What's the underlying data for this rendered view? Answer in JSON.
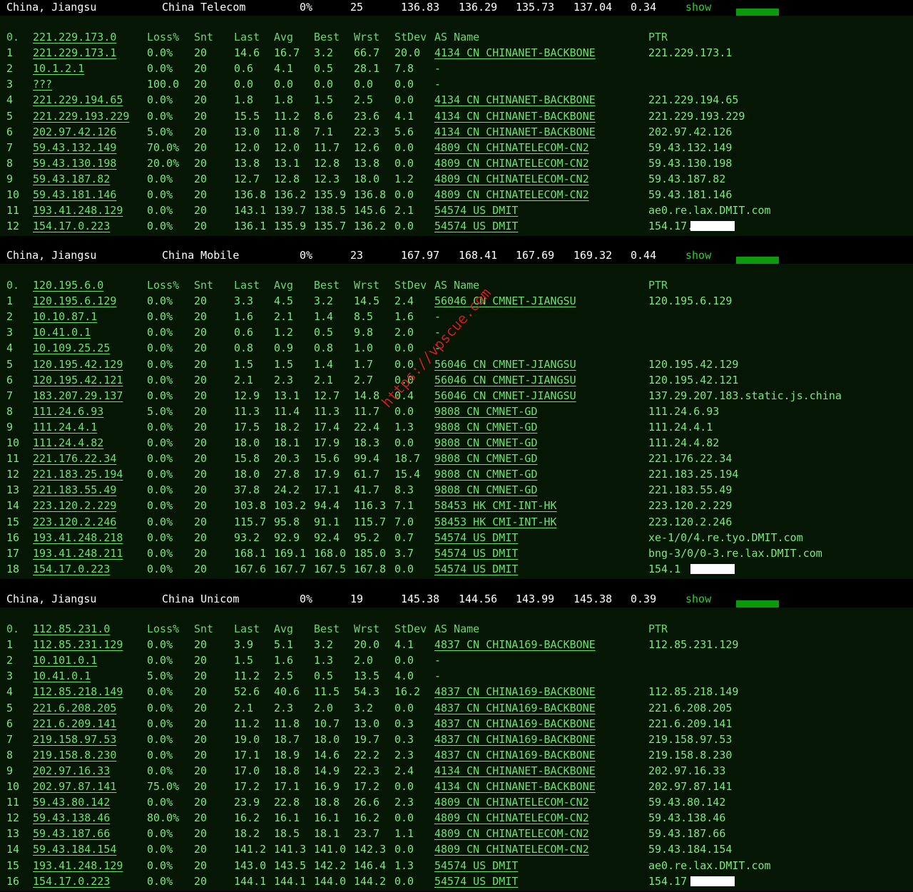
{
  "columns": {
    "hop": "0.",
    "loss": "Loss%",
    "snt": "Snt",
    "last": "Last",
    "avg": "Avg",
    "best": "Best",
    "wrst": "Wrst",
    "stdev": "StDev",
    "asname": "AS Name",
    "ptr": "PTR"
  },
  "sections": [
    {
      "header": {
        "location": "China, Jiangsu",
        "isp": "China Telecom",
        "loss": "0%",
        "hops": "25",
        "v1": "136.83",
        "v2": "136.29",
        "v3": "135.73",
        "v4": "137.04",
        "v5": "0.34",
        "show": "show"
      },
      "first_ip": "221.229.173.0",
      "rows": [
        {
          "n": "1",
          "ip": "221.229.173.1",
          "loss": "0.0%",
          "snt": "20",
          "last": "14.6",
          "avg": "16.7",
          "best": "3.2",
          "wrst": "66.7",
          "stdev": "20.0",
          "as": "4134  CN CHINANET-BACKBONE",
          "ptr": "221.229.173.1"
        },
        {
          "n": "2",
          "ip": "10.1.2.1",
          "loss": "0.0%",
          "snt": "20",
          "last": "0.6",
          "avg": "4.1",
          "best": "0.5",
          "wrst": "28.1",
          "stdev": "7.8",
          "as": "-",
          "ptr": ""
        },
        {
          "n": "3",
          "ip": "???",
          "loss": "100.0",
          "snt": "20",
          "last": "0.0",
          "avg": "0.0",
          "best": "0.0",
          "wrst": "0.0",
          "stdev": "0.0",
          "as": "-",
          "ptr": ""
        },
        {
          "n": "4",
          "ip": "221.229.194.65",
          "loss": "0.0%",
          "snt": "20",
          "last": "1.8",
          "avg": "1.8",
          "best": "1.5",
          "wrst": "2.5",
          "stdev": "0.0",
          "as": "4134  CN CHINANET-BACKBONE",
          "ptr": "221.229.194.65"
        },
        {
          "n": "5",
          "ip": "221.229.193.229",
          "loss": "0.0%",
          "snt": "20",
          "last": "15.5",
          "avg": "11.2",
          "best": "8.6",
          "wrst": "23.6",
          "stdev": "4.1",
          "as": "4134  CN CHINANET-BACKBONE",
          "ptr": "221.229.193.229"
        },
        {
          "n": "6",
          "ip": "202.97.42.126",
          "loss": "5.0%",
          "snt": "20",
          "last": "13.0",
          "avg": "11.8",
          "best": "7.1",
          "wrst": "22.3",
          "stdev": "5.6",
          "as": "4134  CN CHINANET-BACKBONE",
          "ptr": "202.97.42.126"
        },
        {
          "n": "7",
          "ip": "59.43.132.149",
          "loss": "70.0%",
          "snt": "20",
          "last": "12.0",
          "avg": "12.0",
          "best": "11.7",
          "wrst": "12.6",
          "stdev": "0.0",
          "as": "4809  CN CHINATELECOM-CN2",
          "ptr": "59.43.132.149"
        },
        {
          "n": "8",
          "ip": "59.43.130.198",
          "loss": "20.0%",
          "snt": "20",
          "last": "13.8",
          "avg": "13.1",
          "best": "12.8",
          "wrst": "13.8",
          "stdev": "0.0",
          "as": "4809  CN CHINATELECOM-CN2",
          "ptr": "59.43.130.198"
        },
        {
          "n": "9",
          "ip": "59.43.187.82",
          "loss": "0.0%",
          "snt": "20",
          "last": "12.7",
          "avg": "12.8",
          "best": "12.3",
          "wrst": "18.0",
          "stdev": "1.2",
          "as": "4809  CN CHINATELECOM-CN2",
          "ptr": "59.43.187.82"
        },
        {
          "n": "10",
          "ip": "59.43.181.146",
          "loss": "0.0%",
          "snt": "20",
          "last": "136.8",
          "avg": "136.2",
          "best": "135.9",
          "wrst": "136.8",
          "stdev": "0.0",
          "as": "4809  CN CHINATELECOM-CN2",
          "ptr": "59.43.181.146"
        },
        {
          "n": "11",
          "ip": "193.41.248.129",
          "loss": "0.0%",
          "snt": "20",
          "last": "143.1",
          "avg": "139.7",
          "best": "138.5",
          "wrst": "145.6",
          "stdev": "2.1",
          "as": "54574 US DMIT",
          "ptr": "ae0.re.lax.DMIT.com"
        },
        {
          "n": "12",
          "ip": "154.17.0.223",
          "loss": "0.0%",
          "snt": "20",
          "last": "136.1",
          "avg": "135.9",
          "best": "135.7",
          "wrst": "136.2",
          "stdev": "0.0",
          "as": "54574 US DMIT",
          "ptr": "154.17.",
          "mask": true
        }
      ]
    },
    {
      "header": {
        "location": "China, Jiangsu",
        "isp": "China Mobile",
        "loss": "0%",
        "hops": "23",
        "v1": "167.97",
        "v2": "168.41",
        "v3": "167.69",
        "v4": "169.32",
        "v5": "0.44",
        "show": "show"
      },
      "first_ip": "120.195.6.0",
      "rows": [
        {
          "n": "1",
          "ip": "120.195.6.129",
          "loss": "0.0%",
          "snt": "20",
          "last": "3.3",
          "avg": "4.5",
          "best": "3.2",
          "wrst": "14.5",
          "stdev": "2.4",
          "as": "56046 CN CMNET-JIANGSU",
          "ptr": "120.195.6.129"
        },
        {
          "n": "2",
          "ip": "10.10.87.1",
          "loss": "0.0%",
          "snt": "20",
          "last": "1.6",
          "avg": "2.1",
          "best": "1.4",
          "wrst": "8.5",
          "stdev": "1.6",
          "as": "-",
          "ptr": ""
        },
        {
          "n": "3",
          "ip": "10.41.0.1",
          "loss": "0.0%",
          "snt": "20",
          "last": "0.6",
          "avg": "1.2",
          "best": "0.5",
          "wrst": "9.8",
          "stdev": "2.0",
          "as": "-",
          "ptr": ""
        },
        {
          "n": "4",
          "ip": "10.109.25.25",
          "loss": "0.0%",
          "snt": "20",
          "last": "0.8",
          "avg": "0.9",
          "best": "0.8",
          "wrst": "1.0",
          "stdev": "0.0",
          "as": "-",
          "ptr": ""
        },
        {
          "n": "5",
          "ip": "120.195.42.129",
          "loss": "0.0%",
          "snt": "20",
          "last": "1.5",
          "avg": "1.5",
          "best": "1.4",
          "wrst": "1.7",
          "stdev": "0.0",
          "as": "56046 CN CMNET-JIANGSU",
          "ptr": "120.195.42.129"
        },
        {
          "n": "6",
          "ip": "120.195.42.121",
          "loss": "0.0%",
          "snt": "20",
          "last": "2.1",
          "avg": "2.3",
          "best": "2.1",
          "wrst": "2.7",
          "stdev": "0.0",
          "as": "56046 CN CMNET-JIANGSU",
          "ptr": "120.195.42.121"
        },
        {
          "n": "7",
          "ip": "183.207.29.137",
          "loss": "0.0%",
          "snt": "20",
          "last": "12.9",
          "avg": "13.1",
          "best": "12.7",
          "wrst": "14.8",
          "stdev": "0.4",
          "as": "56046 CN CMNET-JIANGSU",
          "ptr": "137.29.207.183.static.js.china"
        },
        {
          "n": "8",
          "ip": "111.24.6.93",
          "loss": "5.0%",
          "snt": "20",
          "last": "11.3",
          "avg": "11.4",
          "best": "11.3",
          "wrst": "11.7",
          "stdev": "0.0",
          "as": "9808  CN CMNET-GD",
          "ptr": "111.24.6.93"
        },
        {
          "n": "9",
          "ip": "111.24.4.1",
          "loss": "0.0%",
          "snt": "20",
          "last": "17.5",
          "avg": "18.2",
          "best": "17.4",
          "wrst": "22.4",
          "stdev": "1.3",
          "as": "9808  CN CMNET-GD",
          "ptr": "111.24.4.1"
        },
        {
          "n": "10",
          "ip": "111.24.4.82",
          "loss": "0.0%",
          "snt": "20",
          "last": "18.0",
          "avg": "18.1",
          "best": "17.9",
          "wrst": "18.3",
          "stdev": "0.0",
          "as": "9808  CN CMNET-GD",
          "ptr": "111.24.4.82"
        },
        {
          "n": "11",
          "ip": "221.176.22.34",
          "loss": "0.0%",
          "snt": "20",
          "last": "15.8",
          "avg": "20.3",
          "best": "15.6",
          "wrst": "99.4",
          "stdev": "18.7",
          "as": "9808  CN CMNET-GD",
          "ptr": "221.176.22.34"
        },
        {
          "n": "12",
          "ip": "221.183.25.194",
          "loss": "0.0%",
          "snt": "20",
          "last": "18.0",
          "avg": "27.8",
          "best": "17.9",
          "wrst": "61.7",
          "stdev": "15.4",
          "as": "9808  CN CMNET-GD",
          "ptr": "221.183.25.194"
        },
        {
          "n": "13",
          "ip": "221.183.55.49",
          "loss": "0.0%",
          "snt": "20",
          "last": "37.8",
          "avg": "24.2",
          "best": "17.1",
          "wrst": "41.7",
          "stdev": "8.3",
          "as": "9808  CN CMNET-GD",
          "ptr": "221.183.55.49"
        },
        {
          "n": "14",
          "ip": "223.120.2.229",
          "loss": "0.0%",
          "snt": "20",
          "last": "103.8",
          "avg": "103.2",
          "best": "94.4",
          "wrst": "116.3",
          "stdev": "7.1",
          "as": "58453 HK CMI-INT-HK",
          "ptr": "223.120.2.229"
        },
        {
          "n": "15",
          "ip": "223.120.2.246",
          "loss": "0.0%",
          "snt": "20",
          "last": "115.7",
          "avg": "95.8",
          "best": "91.1",
          "wrst": "115.7",
          "stdev": "7.0",
          "as": "58453 HK CMI-INT-HK",
          "ptr": "223.120.2.246"
        },
        {
          "n": "16",
          "ip": "193.41.248.218",
          "loss": "0.0%",
          "snt": "20",
          "last": "93.2",
          "avg": "92.9",
          "best": "92.4",
          "wrst": "95.2",
          "stdev": "0.7",
          "as": "54574 US DMIT",
          "ptr": "xe-1/0/4.re.tyo.DMIT.com"
        },
        {
          "n": "17",
          "ip": "193.41.248.211",
          "loss": "0.0%",
          "snt": "20",
          "last": "168.1",
          "avg": "169.1",
          "best": "168.0",
          "wrst": "185.0",
          "stdev": "3.7",
          "as": "54574 US DMIT",
          "ptr": "bng-3/0/0-3.re.lax.DMIT.com"
        },
        {
          "n": "18",
          "ip": "154.17.0.223",
          "loss": "0.0%",
          "snt": "20",
          "last": "167.6",
          "avg": "167.7",
          "best": "167.5",
          "wrst": "167.8",
          "stdev": "0.0",
          "as": "54574 US DMIT",
          "ptr": "154.1",
          "mask": true
        }
      ]
    },
    {
      "header": {
        "location": "China, Jiangsu",
        "isp": "China Unicom",
        "loss": "0%",
        "hops": "19",
        "v1": "145.38",
        "v2": "144.56",
        "v3": "143.99",
        "v4": "145.38",
        "v5": "0.39",
        "show": "show"
      },
      "first_ip": "112.85.231.0",
      "rows": [
        {
          "n": "1",
          "ip": "112.85.231.129",
          "loss": "0.0%",
          "snt": "20",
          "last": "3.9",
          "avg": "5.1",
          "best": "3.2",
          "wrst": "20.0",
          "stdev": "4.1",
          "as": "4837  CN CHINA169-BACKBONE",
          "ptr": "112.85.231.129"
        },
        {
          "n": "2",
          "ip": "10.101.0.1",
          "loss": "0.0%",
          "snt": "20",
          "last": "1.5",
          "avg": "1.6",
          "best": "1.3",
          "wrst": "2.0",
          "stdev": "0.0",
          "as": "-",
          "ptr": ""
        },
        {
          "n": "3",
          "ip": "10.41.0.1",
          "loss": "5.0%",
          "snt": "20",
          "last": "11.2",
          "avg": "2.5",
          "best": "0.5",
          "wrst": "13.5",
          "stdev": "4.0",
          "as": "-",
          "ptr": ""
        },
        {
          "n": "4",
          "ip": "112.85.218.149",
          "loss": "0.0%",
          "snt": "20",
          "last": "52.6",
          "avg": "40.6",
          "best": "11.5",
          "wrst": "54.3",
          "stdev": "16.2",
          "as": "4837  CN CHINA169-BACKBONE",
          "ptr": "112.85.218.149"
        },
        {
          "n": "5",
          "ip": "221.6.208.205",
          "loss": "0.0%",
          "snt": "20",
          "last": "2.1",
          "avg": "2.3",
          "best": "2.0",
          "wrst": "3.2",
          "stdev": "0.0",
          "as": "4837  CN CHINA169-BACKBONE",
          "ptr": "221.6.208.205"
        },
        {
          "n": "6",
          "ip": "221.6.209.141",
          "loss": "0.0%",
          "snt": "20",
          "last": "11.2",
          "avg": "11.8",
          "best": "10.7",
          "wrst": "13.0",
          "stdev": "0.3",
          "as": "4837  CN CHINA169-BACKBONE",
          "ptr": "221.6.209.141"
        },
        {
          "n": "7",
          "ip": "219.158.97.53",
          "loss": "0.0%",
          "snt": "20",
          "last": "19.0",
          "avg": "18.7",
          "best": "18.0",
          "wrst": "19.7",
          "stdev": "0.3",
          "as": "4837  CN CHINA169-BACKBONE",
          "ptr": "219.158.97.53"
        },
        {
          "n": "8",
          "ip": "219.158.8.230",
          "loss": "0.0%",
          "snt": "20",
          "last": "17.1",
          "avg": "18.9",
          "best": "14.6",
          "wrst": "22.2",
          "stdev": "2.3",
          "as": "4837  CN CHINA169-BACKBONE",
          "ptr": "219.158.8.230"
        },
        {
          "n": "9",
          "ip": "202.97.16.33",
          "loss": "0.0%",
          "snt": "20",
          "last": "17.0",
          "avg": "18.8",
          "best": "14.9",
          "wrst": "22.3",
          "stdev": "2.4",
          "as": "4134  CN CHINANET-BACKBONE",
          "ptr": "202.97.16.33"
        },
        {
          "n": "10",
          "ip": "202.97.87.141",
          "loss": "75.0%",
          "snt": "20",
          "last": "17.2",
          "avg": "17.1",
          "best": "16.9",
          "wrst": "17.2",
          "stdev": "0.0",
          "as": "4134  CN CHINANET-BACKBONE",
          "ptr": "202.97.87.141"
        },
        {
          "n": "11",
          "ip": "59.43.80.142",
          "loss": "0.0%",
          "snt": "20",
          "last": "23.9",
          "avg": "22.8",
          "best": "18.8",
          "wrst": "26.6",
          "stdev": "2.3",
          "as": "4809  CN CHINATELECOM-CN2",
          "ptr": "59.43.80.142"
        },
        {
          "n": "12",
          "ip": "59.43.138.46",
          "loss": "80.0%",
          "snt": "20",
          "last": "16.2",
          "avg": "16.1",
          "best": "16.1",
          "wrst": "16.2",
          "stdev": "0.0",
          "as": "4809  CN CHINATELECOM-CN2",
          "ptr": "59.43.138.46"
        },
        {
          "n": "13",
          "ip": "59.43.187.66",
          "loss": "0.0%",
          "snt": "20",
          "last": "18.2",
          "avg": "18.5",
          "best": "18.1",
          "wrst": "23.7",
          "stdev": "1.1",
          "as": "4809  CN CHINATELECOM-CN2",
          "ptr": "59.43.187.66"
        },
        {
          "n": "14",
          "ip": "59.43.184.154",
          "loss": "0.0%",
          "snt": "20",
          "last": "141.2",
          "avg": "141.3",
          "best": "141.0",
          "wrst": "142.3",
          "stdev": "0.0",
          "as": "4809  CN CHINATELECOM-CN2",
          "ptr": "59.43.184.154"
        },
        {
          "n": "15",
          "ip": "193.41.248.129",
          "loss": "0.0%",
          "snt": "20",
          "last": "143.0",
          "avg": "143.5",
          "best": "142.2",
          "wrst": "146.4",
          "stdev": "1.3",
          "as": "54574 US DMIT",
          "ptr": "ae0.re.lax.DMIT.com"
        },
        {
          "n": "16",
          "ip": "154.17.0.223",
          "loss": "0.0%",
          "snt": "20",
          "last": "144.1",
          "avg": "144.1",
          "best": "144.0",
          "wrst": "144.2",
          "stdev": "0.0",
          "as": "54574 US DMIT",
          "ptr": "154.17",
          "mask": true
        }
      ]
    }
  ],
  "watermark": "https://vpscue.com"
}
